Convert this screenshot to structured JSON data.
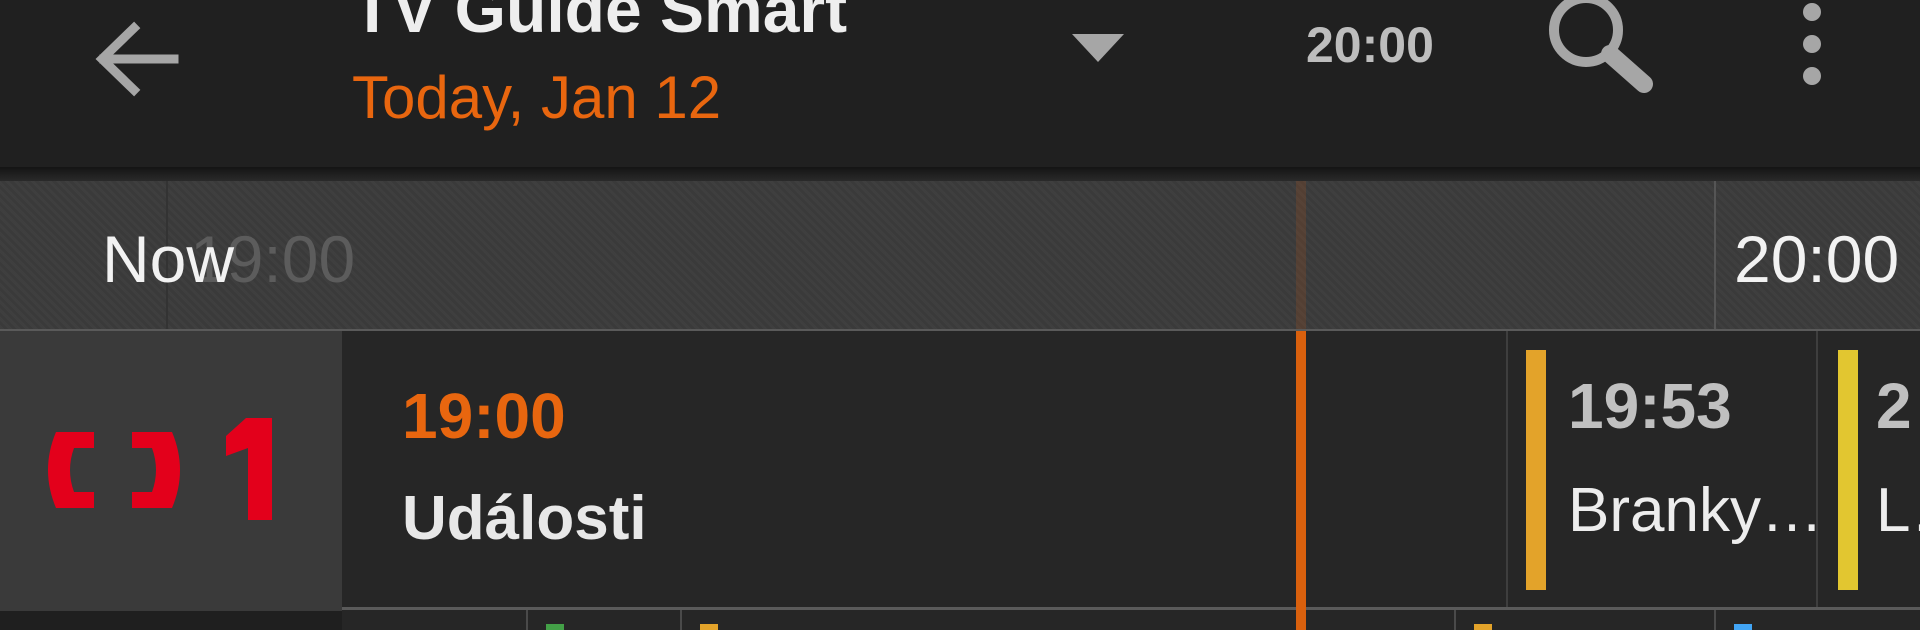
{
  "appbar": {
    "title": "TV Guide Smart",
    "date": "Today, Jan 12",
    "clock": "20:00",
    "icons": {
      "back": "arrow-back-icon",
      "dropdown": "dropdown-triangle-icon",
      "search": "search-icon",
      "menu": "more-vert-icon"
    }
  },
  "timeline": {
    "now_label": "Now",
    "faded_time": "19:00",
    "time_mark": "20:00"
  },
  "channel": {
    "logo_text": "ČT1"
  },
  "programmes": [
    {
      "time": "19:00",
      "title": "Události"
    },
    {
      "time": "19:53",
      "title": "Branky…"
    },
    {
      "time": "2",
      "title": "L…"
    }
  ],
  "colors": {
    "accent": "#e8660f",
    "now_line": "#d9600d",
    "logo": "#e3001b",
    "genre_orange": "#e3a32a",
    "genre_yellow": "#e2c630",
    "peek_green": "#43a047",
    "peek_orange": "#e3a32a",
    "peek_blue": "#42a5f5"
  }
}
